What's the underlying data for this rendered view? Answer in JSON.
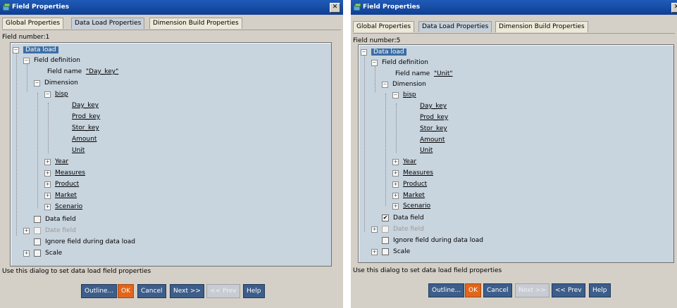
{
  "dialogs": [
    {
      "title": "Field Properties",
      "tabs": [
        "Global Properties",
        "Data Load Properties",
        "Dimension Build Properties"
      ],
      "field_number": "Field number:1",
      "tree": {
        "root": "Data load",
        "field_definition": "Field definition",
        "field_name_label": "Field name",
        "field_name_value": "\"Day_key\"",
        "dimension": "Dimension",
        "bisp": "bisp",
        "bisp_children": [
          "Day_key",
          "Prod_key",
          "Stor_key",
          "Amount",
          "Unit"
        ],
        "dimensions": [
          "Year",
          "Measures",
          "Product",
          "Market",
          "Scenario"
        ],
        "data_field": "Data field",
        "data_field_checked": false,
        "date_field": "Date field",
        "ignore_field": "Ignore field during data load",
        "scale": "Scale"
      },
      "hint": "Use this dialog to set data load field properties",
      "buttons": {
        "outline": "Outline...",
        "ok": "OK",
        "cancel": "Cancel",
        "next": "Next >>",
        "prev": "<< Prev",
        "help": "Help"
      },
      "next_enabled": true,
      "prev_enabled": false
    },
    {
      "title": "Field Properties",
      "tabs": [
        "Global Properties",
        "Data Load Properties",
        "Dimension Build Properties"
      ],
      "field_number": "Field number:5",
      "tree": {
        "root": "Data load",
        "field_definition": "Field definition",
        "field_name_label": "Field name",
        "field_name_value": "\"Unit\"",
        "dimension": "Dimension",
        "bisp": "bisp",
        "bisp_children": [
          "Day_key",
          "Prod_key",
          "Stor_key",
          "Amount",
          "Unit"
        ],
        "dimensions": [
          "Year",
          "Measures",
          "Product",
          "Market",
          "Scenario"
        ],
        "data_field": "Data field",
        "data_field_checked": true,
        "date_field": "Date field",
        "ignore_field": "Ignore field during data load",
        "scale": "Scale"
      },
      "hint": "Use this dialog to set data load field properties",
      "buttons": {
        "outline": "Outline...",
        "ok": "OK",
        "cancel": "Cancel",
        "next": "Next >>",
        "prev": "<< Prev",
        "help": "Help"
      },
      "next_enabled": false,
      "prev_enabled": true
    }
  ],
  "colors": {
    "title_bar": "#1f5bb8",
    "tree_background": "#c8d4de",
    "selection": "#3b6ea5",
    "ok_button": "#e0661b",
    "button": "#3d5e8a"
  },
  "icons": {
    "app": "field-properties-icon",
    "close": "close-icon",
    "collapse": "minus-box-icon",
    "expand": "plus-box-icon"
  }
}
